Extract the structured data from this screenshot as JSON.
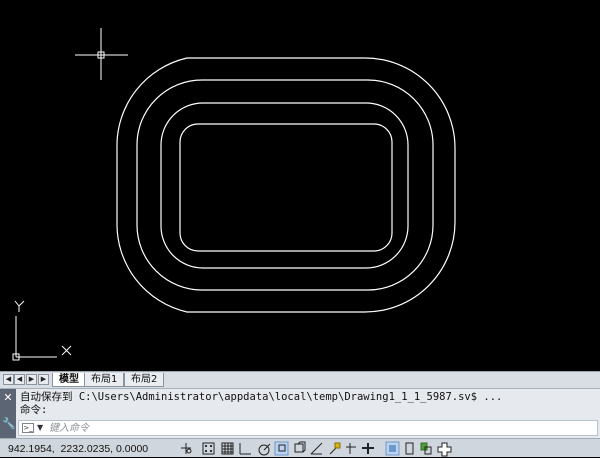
{
  "layout_tabs": [
    {
      "label": "模型",
      "active": true
    },
    {
      "label": "布局1",
      "active": false
    },
    {
      "label": "布局2",
      "active": false
    }
  ],
  "ucs": {
    "x_label": "X",
    "y_label": "Y"
  },
  "command": {
    "history": [
      "自动保存到 C:\\Users\\Administrator\\appdata\\local\\temp\\Drawing1_1_1_5987.sv$ ...",
      "命令:"
    ],
    "placeholder": "键入命令"
  },
  "status": {
    "coordinates": "942.1954,  2232.0235, 0.0000"
  },
  "colors": {
    "canvas": "#000000",
    "geometry": "#ffffff",
    "status_bar": "#d0d6dd",
    "active_toggle": "#b9d3f0"
  },
  "toolbar_icons": [
    "infer-constraints-icon",
    "snap-mode-icon",
    "grid-display-icon",
    "ortho-mode-icon",
    "polar-tracking-icon",
    "object-snap-icon",
    "3d-object-snap-icon",
    "object-snap-tracking-icon",
    "dynamic-ucs-icon",
    "dynamic-input-icon",
    "lineweight-icon",
    "transparency-icon",
    "quick-properties-icon",
    "selection-cycling-icon",
    "annotation-monitor-icon"
  ]
}
